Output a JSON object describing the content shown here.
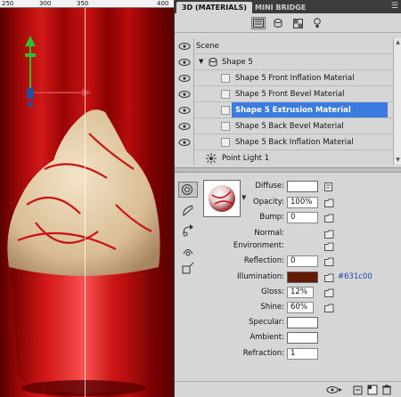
{
  "ruler": {
    "ticks": [
      "250",
      "300",
      "350",
      "400"
    ]
  },
  "panel": {
    "tabs": [
      {
        "label": "3D (MATERIALS)",
        "active": true
      },
      {
        "label": "MINI BRIDGE",
        "active": false
      }
    ],
    "menu_icon": "panel-menu-icon",
    "scene": {
      "root_label": "Scene",
      "group_label": "Shape 5",
      "items": [
        {
          "label": "Shape 5 Front Inflation Material",
          "selected": false
        },
        {
          "label": "Shape 5 Front Bevel Material",
          "selected": false
        },
        {
          "label": "Shape 5 Extrusion Material",
          "selected": true
        },
        {
          "label": "Shape 5 Back Bevel Material",
          "selected": false
        },
        {
          "label": "Shape 5 Back Inflation Material",
          "selected": false
        }
      ],
      "light_label": "Point Light 1"
    },
    "properties": {
      "diffuse": {
        "label": "Diffuse:",
        "value": ""
      },
      "opacity": {
        "label": "Opacity:",
        "value": "100%"
      },
      "bump": {
        "label": "Bump:",
        "value": "0"
      },
      "normal": {
        "label": "Normal:"
      },
      "environment": {
        "label": "Environment:"
      },
      "reflection": {
        "label": "Reflection:",
        "value": "0"
      },
      "illumination": {
        "label": "Illumination:",
        "color": "#631c00",
        "hex_label": "#631c00"
      },
      "gloss": {
        "label": "Gloss:",
        "value": "12%"
      },
      "shine": {
        "label": "Shine:",
        "value": "60%"
      },
      "specular": {
        "label": "Specular:",
        "value": ""
      },
      "ambient": {
        "label": "Ambient:",
        "value": ""
      },
      "refraction": {
        "label": "Refraction:",
        "value": "1"
      }
    }
  },
  "colors": {
    "selection": "#3b7be0",
    "illumination": "#631c00",
    "panel_bg": "#d6d6d6"
  }
}
